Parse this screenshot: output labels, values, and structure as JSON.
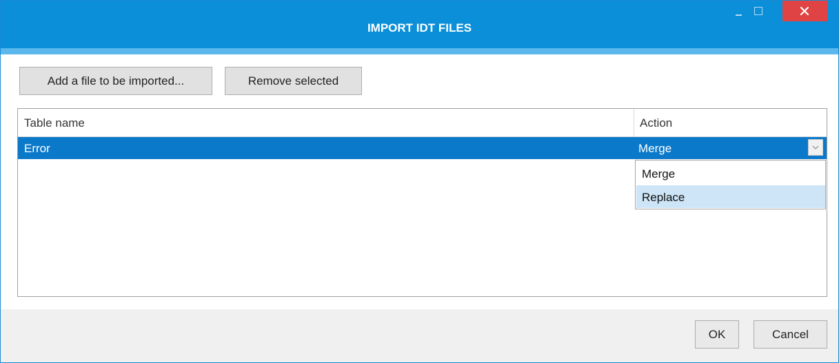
{
  "window": {
    "title": "IMPORT IDT FILES",
    "title_color": "#0b8fd8",
    "accent_color": "#5cb7ec"
  },
  "toolbar": {
    "add_label": "Add a file to be imported...",
    "remove_label": "Remove selected"
  },
  "table": {
    "columns": [
      "Table name",
      "Action"
    ],
    "rows": [
      {
        "name": "Error",
        "action": "Merge",
        "selected": true
      }
    ],
    "selection_color": "#0b79ca"
  },
  "action_dropdown": {
    "options": [
      "Merge",
      "Replace"
    ],
    "highlighted": "Replace"
  },
  "footer": {
    "ok_label": "OK",
    "cancel_label": "Cancel"
  },
  "icons": {
    "minimize": "minimize-icon",
    "maximize": "maximize-icon",
    "close": "close-icon",
    "dropdown": "chevron-down-icon"
  }
}
